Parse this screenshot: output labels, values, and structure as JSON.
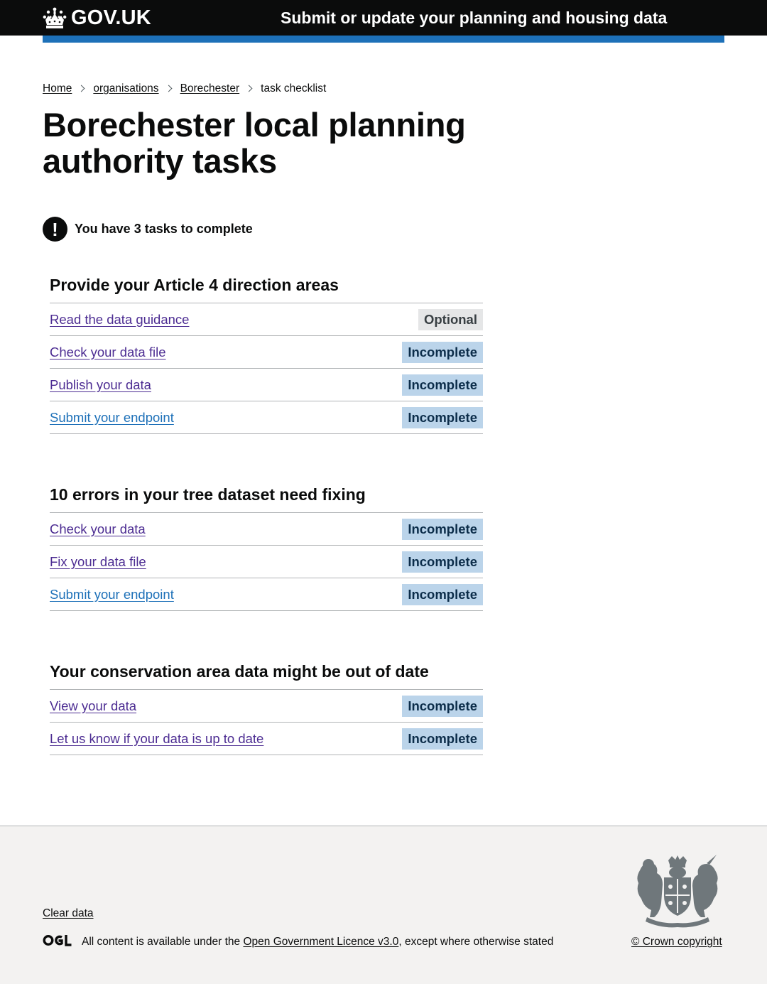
{
  "header": {
    "logo_text": "GOV.UK",
    "service_name": "Submit or update your planning and housing data"
  },
  "breadcrumbs": [
    {
      "label": "Home"
    },
    {
      "label": "organisations"
    },
    {
      "label": "Borechester"
    },
    {
      "label": "task checklist"
    }
  ],
  "page_title": "Borechester local planning authority tasks",
  "warning": {
    "icon": "!",
    "text": "You have 3 tasks to complete"
  },
  "sections": [
    {
      "heading": "Provide your Article 4 direction areas",
      "tasks": [
        {
          "label": "Read the data guidance",
          "status": "Optional"
        },
        {
          "label": "Check your data file",
          "status": "Incomplete"
        },
        {
          "label": "Publish your data",
          "status": "Incomplete"
        },
        {
          "label": "Submit your endpoint",
          "status": "Incomplete"
        }
      ]
    },
    {
      "heading": "10 errors in your tree dataset need fixing",
      "tasks": [
        {
          "label": "Check your data",
          "status": "Incomplete"
        },
        {
          "label": "Fix your data file",
          "status": "Incomplete"
        },
        {
          "label": "Submit your endpoint",
          "status": "Incomplete"
        }
      ]
    },
    {
      "heading": "Your conservation area data might be out of date",
      "tasks": [
        {
          "label": "View your data",
          "status": "Incomplete"
        },
        {
          "label": "Let us know if your data is up to date",
          "status": "Incomplete"
        }
      ]
    }
  ],
  "footer": {
    "clear_data": "Clear data",
    "licence_prefix": "All content is available under the ",
    "licence_link": "Open Government Licence v3.0",
    "licence_suffix": ", except where otherwise stated",
    "copyright": "© Crown copyright",
    "ogl_label": "OGL"
  },
  "colors": {
    "header_bg": "#0b0c0c",
    "accent_bar": "#1d70b8",
    "visited_link": "#4c2c92",
    "link": "#1d70b8",
    "tag_blue_bg": "#bbd4ea",
    "tag_grey_bg": "#e5e6e7",
    "footer_bg": "#f3f2f1"
  }
}
